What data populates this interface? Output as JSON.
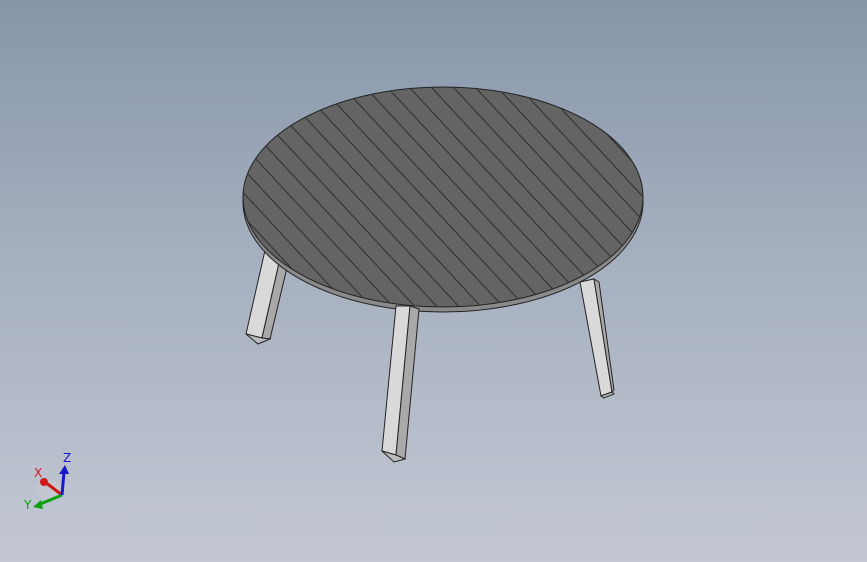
{
  "viewport": {
    "model": "round-table",
    "background_top": "#8896aa",
    "background_bottom": "#c3c8d3"
  },
  "table": {
    "top_color": "#646464",
    "slat_line_color": "#2e2e2e",
    "leg_color": "#d9d9d9",
    "leg_shadow_color": "#a9a9a9",
    "edge_color": "#222222"
  },
  "triad": {
    "x_label": "X",
    "y_label": "Y",
    "z_label": "Z",
    "x_color": "#d01818",
    "y_color": "#10a010",
    "z_color": "#1818c8"
  }
}
